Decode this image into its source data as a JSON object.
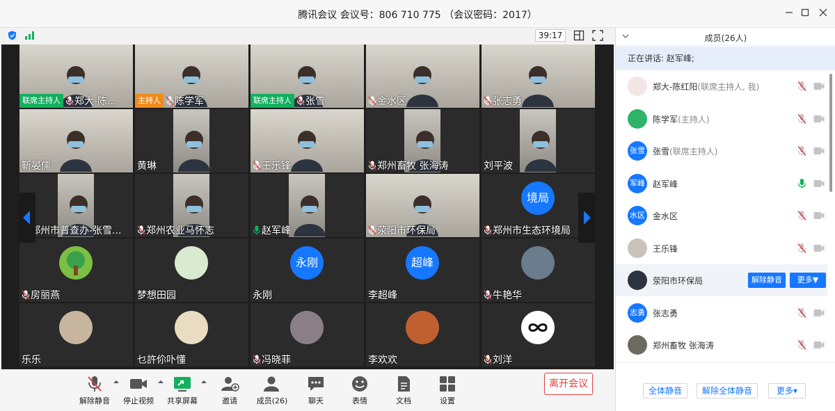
{
  "window": {
    "title": "腾讯会议 会议号：806 710 775 （会议密码：2017）"
  },
  "video_bar": {
    "timer": "39:17"
  },
  "tiles": [
    {
      "badge": "联席主持人",
      "badge_color": "#13b05e",
      "name": "郑大-陈...",
      "mic": "muted"
    },
    {
      "badge": "主持人",
      "badge_color": "#f08c1d",
      "name": "陈学军",
      "mic": "muted"
    },
    {
      "badge": "联席主持人",
      "badge_color": "#13b05e",
      "name": "张雪",
      "mic": "muted"
    },
    {
      "name": "金水区",
      "mic": "muted"
    },
    {
      "name": "张志勇",
      "mic": "muted"
    },
    {
      "name": "靳晏儒",
      "mic": "none"
    },
    {
      "name": "黄琳",
      "mic": "none"
    },
    {
      "name": "王乐锋",
      "mic": "muted"
    },
    {
      "name": "郑州畜牧 张海涛",
      "mic": "muted"
    },
    {
      "name": "刘平波",
      "mic": "none"
    },
    {
      "name": "郑州市普查办-张雪...",
      "mic": "muted"
    },
    {
      "name": "郑州农业马怀志",
      "mic": "muted"
    },
    {
      "name": "赵军峰",
      "mic": "active"
    },
    {
      "name": "荥阳市环保局",
      "mic": "muted"
    },
    {
      "name": "郑州市生态环境局",
      "mic": "muted",
      "avatar_text": "境局"
    },
    {
      "name": "房丽燕",
      "mic": "muted"
    },
    {
      "name": "梦想田园",
      "mic": "none"
    },
    {
      "name": "永刚",
      "mic": "none",
      "avatar_text": "永刚"
    },
    {
      "name": "李超峰",
      "mic": "none",
      "avatar_text": "超峰"
    },
    {
      "name": "牛艳华",
      "mic": "muted"
    },
    {
      "name": "乐乐",
      "mic": "none"
    },
    {
      "name": "乜許伱卟懂",
      "mic": "none"
    },
    {
      "name": "冯晓菲",
      "mic": "muted"
    },
    {
      "name": "李欢欢",
      "mic": "none"
    },
    {
      "name": "刘洋",
      "mic": "muted"
    }
  ],
  "toolbar": {
    "mute": "解除静音",
    "stop_video": "停止视频",
    "share": "共享屏幕",
    "invite": "邀请",
    "members": "成员(26)",
    "chat": "聊天",
    "reaction": "表情",
    "docs": "文档",
    "settings": "设置",
    "leave": "离开会议"
  },
  "panel": {
    "title": "成员(26人)",
    "speaking": "正在讲话: 赵军峰;",
    "members": [
      {
        "name": "郑大-陈红阳",
        "role": "(联席主持人, 我)",
        "avatar": "",
        "mic": "muted"
      },
      {
        "name": "陈学军",
        "role": "(主持人)",
        "avatar": "",
        "mic": "muted"
      },
      {
        "name": "张雪",
        "role": "(联席主持人)",
        "avatar": "张雪",
        "mic": "muted"
      },
      {
        "name": "赵军峰",
        "role": "",
        "avatar": "军峰",
        "mic": "active"
      },
      {
        "name": "金水区",
        "role": "",
        "avatar": "水区",
        "mic": "muted"
      },
      {
        "name": "王乐锋",
        "role": "",
        "avatar": "",
        "mic": "muted"
      },
      {
        "name": "荥阳市环保局",
        "role": "",
        "avatar": "",
        "mic": "muted",
        "selected": true
      },
      {
        "name": "张志勇",
        "role": "",
        "avatar": "志勇",
        "mic": "muted"
      },
      {
        "name": "郑州畜牧 张海涛",
        "role": "",
        "avatar": "",
        "mic": "muted"
      }
    ],
    "unmute_btn": "解除静音",
    "more_btn": "更多▼",
    "mute_all": "全体静音",
    "unmute_all": "解除全体静音",
    "more": "更多▾"
  },
  "colors": {
    "accent": "#1677ff",
    "leave": "#e04040",
    "cohost": "#13b05e",
    "host": "#f08c1d"
  }
}
